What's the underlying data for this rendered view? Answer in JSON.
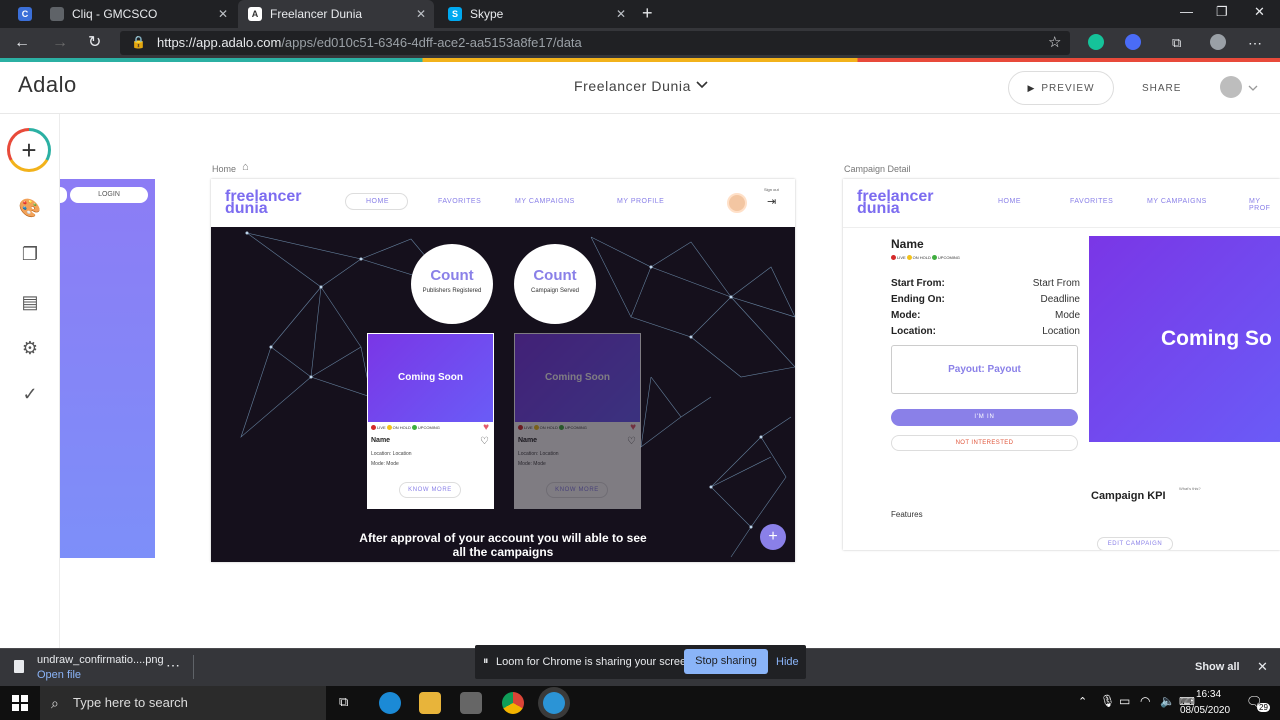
{
  "browser": {
    "tabs": [
      {
        "title": "Cliq - GMCSCO",
        "active": false
      },
      {
        "title": "Freelancer Dunia",
        "active": true
      },
      {
        "title": "Skype",
        "active": false
      }
    ],
    "url_host": "https://app.adalo.com",
    "url_path": "/apps/ed010c51-6346-4dff-ace2-aa5153a8fe17/data"
  },
  "adalo": {
    "logo": "Adalo",
    "app_name": "Freelancer Dunia",
    "preview_label": "PREVIEW",
    "share_label": "SHARE"
  },
  "canvas": {
    "partial_screen": {
      "login_label": "LOGIN"
    },
    "home": {
      "label": "Home",
      "logo_line1": "freelancer",
      "logo_line2": "dunia",
      "nav": [
        "HOME",
        "FAVORITES",
        "MY CAMPAIGNS",
        "MY PROFILE"
      ],
      "signout": "Sign out",
      "counts": [
        {
          "title": "Count",
          "subtitle": "Publishers Registered"
        },
        {
          "title": "Count",
          "subtitle": "Campaign Served"
        }
      ],
      "cards": [
        {
          "image_text": "Coming Soon",
          "status": [
            "LIVE",
            "ON HOLD",
            "UPCOMING"
          ],
          "name": "Name",
          "location": "Location: Location",
          "mode": "Mode: Mode",
          "button": "KNOW MORE"
        },
        {
          "image_text": "Coming Soon",
          "status": [
            "LIVE",
            "ON HOLD",
            "UPCOMING"
          ],
          "name": "Name",
          "location": "Location: Location",
          "mode": "Mode: Mode",
          "button": "KNOW MORE"
        }
      ],
      "approval_text": "After approval of your account you will able to see all the campaigns",
      "fab": "+"
    },
    "detail": {
      "label": "Campaign Detail",
      "logo_line1": "freelancer",
      "logo_line2": "dunia",
      "nav": [
        "HOME",
        "FAVORITES",
        "MY CAMPAIGNS",
        "MY PROF"
      ],
      "name": "Name",
      "status": [
        "LIVE",
        "ON HOLD",
        "UPCOMING"
      ],
      "fields": [
        {
          "label": "Start From:",
          "value": "Start From"
        },
        {
          "label": "Ending On:",
          "value": "Deadline"
        },
        {
          "label": "Mode:",
          "value": "Mode"
        },
        {
          "label": "Location:",
          "value": "Location"
        }
      ],
      "payout": "Payout: Payout",
      "im_in": "I'M IN",
      "not_interested": "NOT INTERESTED",
      "coming_soon": "Coming So",
      "kpi_title": "Campaign KPI",
      "whats_this": "What's this?",
      "features": "Features",
      "edit_campaign": "EDIT CAMPAIGN"
    }
  },
  "download_bar": {
    "filename": "undraw_confirmatio....png",
    "open_file": "Open file",
    "loom_text": "Loom for Chrome is sharing your screen.",
    "stop_sharing": "Stop sharing",
    "hide": "Hide",
    "show_all": "Show all"
  },
  "taskbar": {
    "search_placeholder": "Type here to search",
    "time": "16:34",
    "date": "08/05/2020",
    "notification_count": "29"
  },
  "colors": {
    "accent_purple": "#8a80e8",
    "status_live": "#d42a2a",
    "status_on_hold": "#f2c21b",
    "status_upcoming": "#3fae3f"
  }
}
